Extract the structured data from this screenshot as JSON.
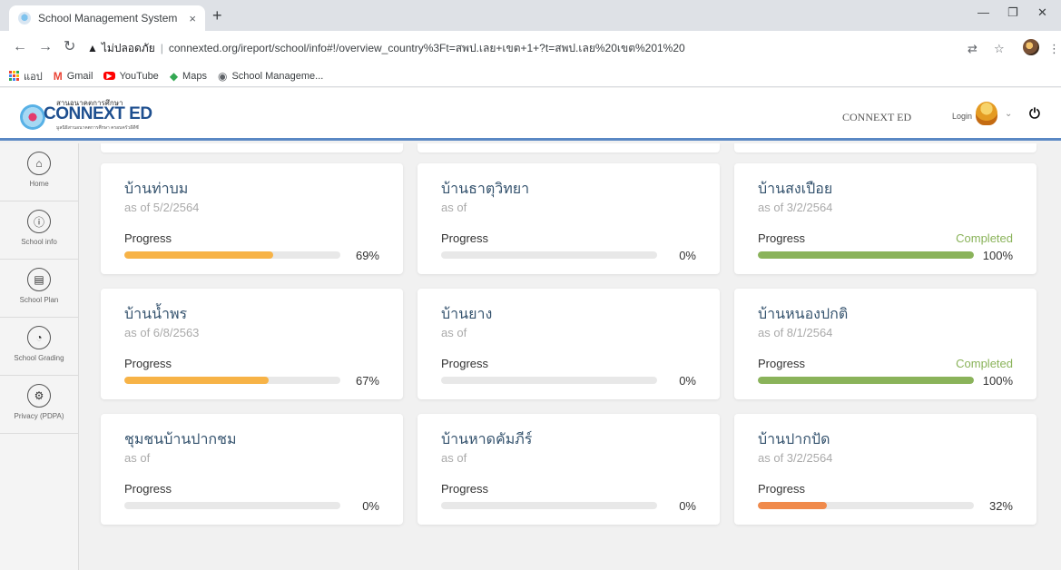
{
  "browser": {
    "tab_title": "School Management System",
    "tab_close": "×",
    "new_tab": "+",
    "insecure_label": "ไม่ปลอดภัย",
    "url": "connexted.org/ireport/school/info#!/overview_country%3Ft=สพป.เลย+เขต+1+?t=สพป.เลย%20เขต%201%20",
    "bookmarks": [
      {
        "label": "แอป",
        "icon": "apps-grid-icon"
      },
      {
        "label": "Gmail",
        "icon": "gmail-icon"
      },
      {
        "label": "YouTube",
        "icon": "youtube-icon"
      },
      {
        "label": "Maps",
        "icon": "maps-icon"
      },
      {
        "label": "School Manageme...",
        "icon": "globe-icon"
      }
    ]
  },
  "header": {
    "logo_top": "สานอนาคตการศึกษา",
    "logo_main": "CONNEXT ED",
    "logo_sub": "มูลนิธิสานอนาคตการศึกษา ครอบครัวอีดีซี",
    "brand": "CONNEXT ED",
    "login": "Login"
  },
  "sidebar": {
    "items": [
      {
        "label": "Home",
        "icon": "home-icon"
      },
      {
        "label": "School info",
        "icon": "school-info-icon"
      },
      {
        "label": "School Plan",
        "icon": "school-plan-icon"
      },
      {
        "label": "School Grading",
        "icon": "grading-pie-icon"
      },
      {
        "label": "Privacy (PDPA)",
        "icon": "gear-icon"
      }
    ]
  },
  "progress_label": "Progress",
  "colors": {
    "orange": "#f7b347",
    "green": "#8ab35a",
    "deep_orange": "#f08a4b",
    "header_accent": "#5a88c4"
  },
  "schools": [
    {
      "name": "บ้านท่าบม",
      "date": "as of 5/2/2564",
      "progress": 69,
      "pct_text": "69%",
      "status": "",
      "color": "#f7b347"
    },
    {
      "name": "บ้านธาตุวิทยา",
      "date": "as of",
      "progress": 0,
      "pct_text": "0%",
      "status": "",
      "color": "#f7b347"
    },
    {
      "name": "บ้านสงเปือย",
      "date": "as of 3/2/2564",
      "progress": 100,
      "pct_text": "100%",
      "status": "Completed",
      "color": "#8ab35a"
    },
    {
      "name": "บ้านน้ำพร",
      "date": "as of 6/8/2563",
      "progress": 67,
      "pct_text": "67%",
      "status": "",
      "color": "#f7b347"
    },
    {
      "name": "บ้านยาง",
      "date": "as of",
      "progress": 0,
      "pct_text": "0%",
      "status": "",
      "color": "#f7b347"
    },
    {
      "name": "บ้านหนองปกติ",
      "date": "as of 8/1/2564",
      "progress": 100,
      "pct_text": "100%",
      "status": "Completed",
      "color": "#8ab35a"
    },
    {
      "name": "ชุมชนบ้านปากชม",
      "date": "as of",
      "progress": 0,
      "pct_text": "0%",
      "status": "",
      "color": "#f7b347"
    },
    {
      "name": "บ้านหาดคัมภีร์",
      "date": "as of",
      "progress": 0,
      "pct_text": "0%",
      "status": "",
      "color": "#f7b347"
    },
    {
      "name": "บ้านปากปัด",
      "date": "as of 3/2/2564",
      "progress": 32,
      "pct_text": "32%",
      "status": "",
      "color": "#f08a4b"
    }
  ]
}
